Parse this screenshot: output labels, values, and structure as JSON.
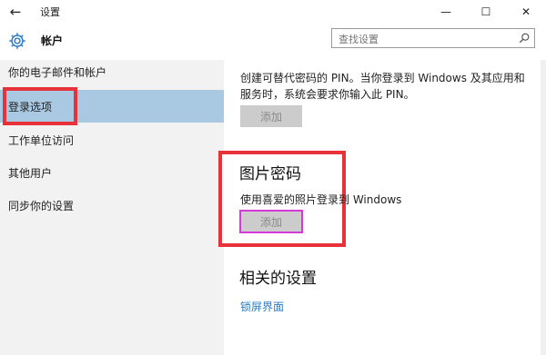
{
  "window": {
    "back_icon": "←",
    "title": "设置",
    "minimize_icon": "—",
    "maximize_icon": "☐",
    "close_icon": "✕"
  },
  "header": {
    "title": "帐户",
    "search_placeholder": "查找设置",
    "search_icon": "search-icon"
  },
  "sidebar": {
    "items": [
      {
        "label": "你的电子邮件和帐户"
      },
      {
        "label": "登录选项",
        "active": true
      },
      {
        "label": "工作单位访问"
      },
      {
        "label": "其他用户"
      },
      {
        "label": "同步你的设置"
      }
    ]
  },
  "main": {
    "pin_description": "创建可替代密码的 PIN。当你登录到 Windows 及其应用和服务时，系统会要求你输入此 PIN。",
    "pin_add_button": "添加",
    "picture_password": {
      "title": "图片密码",
      "description": "使用喜爱的照片登录到 Windows",
      "add_button": "添加"
    },
    "related": {
      "title": "相关的设置",
      "lock_screen_link": "锁屏界面"
    }
  },
  "colors": {
    "annotation": "#e63238",
    "active_item": "#a9c8e1",
    "link": "#2b7bc4",
    "highlight_border": "#d33ad6"
  }
}
